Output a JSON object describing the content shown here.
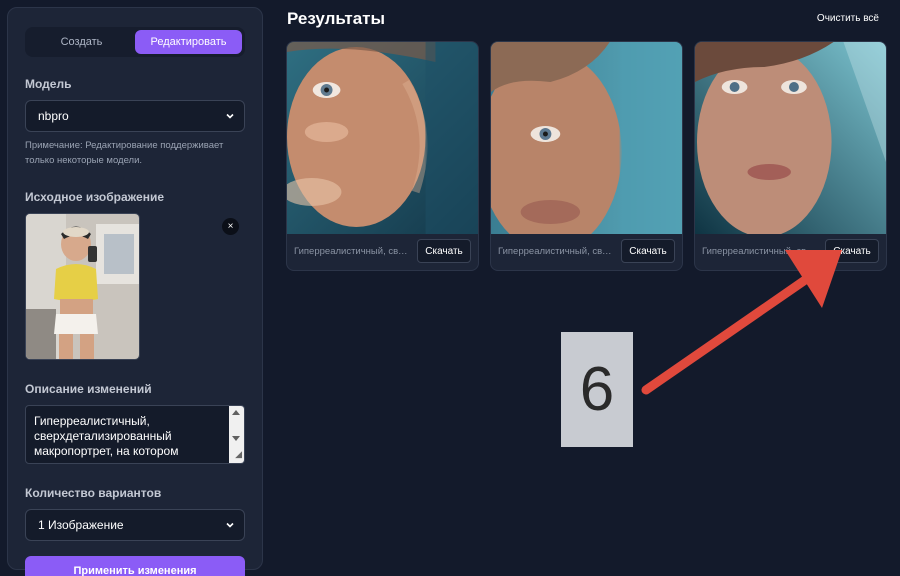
{
  "tabs": {
    "create": "Создать",
    "edit": "Редактировать",
    "active": "edit"
  },
  "model": {
    "label": "Модель",
    "value": "nbpro",
    "note": "Примечание: Редактирование поддерживает только некоторые модели."
  },
  "source": {
    "label": "Исходное изображение",
    "remove": "×"
  },
  "description": {
    "label": "Описание изменений",
    "value": "Гиперреалистичный, сверхдетализированный макропортрет, на котором"
  },
  "variants": {
    "label": "Количество вариантов",
    "value": "1 Изображение"
  },
  "apply": "Применить изменения",
  "results": {
    "title": "Результаты",
    "clear": "Очистить всё",
    "cards": [
      {
        "caption": "Гиперреалистичный, сверхдетализированный макропортрет",
        "download": "Скачать"
      },
      {
        "caption": "Гиперреалистичный, сверхдетализированный макропортрет",
        "download": "Скачать"
      },
      {
        "caption": "Гиперреалистичный, сверхдетализированный макропортрет",
        "download": "Скачать"
      }
    ]
  },
  "overlay": {
    "number": "6"
  },
  "colors": {
    "accent": "#8b5cf6",
    "background": "#131a2b",
    "panel": "#1d2537",
    "arrow": "#e0493c"
  },
  "icons": [
    "chevron-down-icon",
    "close-icon",
    "arrow-annotation"
  ]
}
